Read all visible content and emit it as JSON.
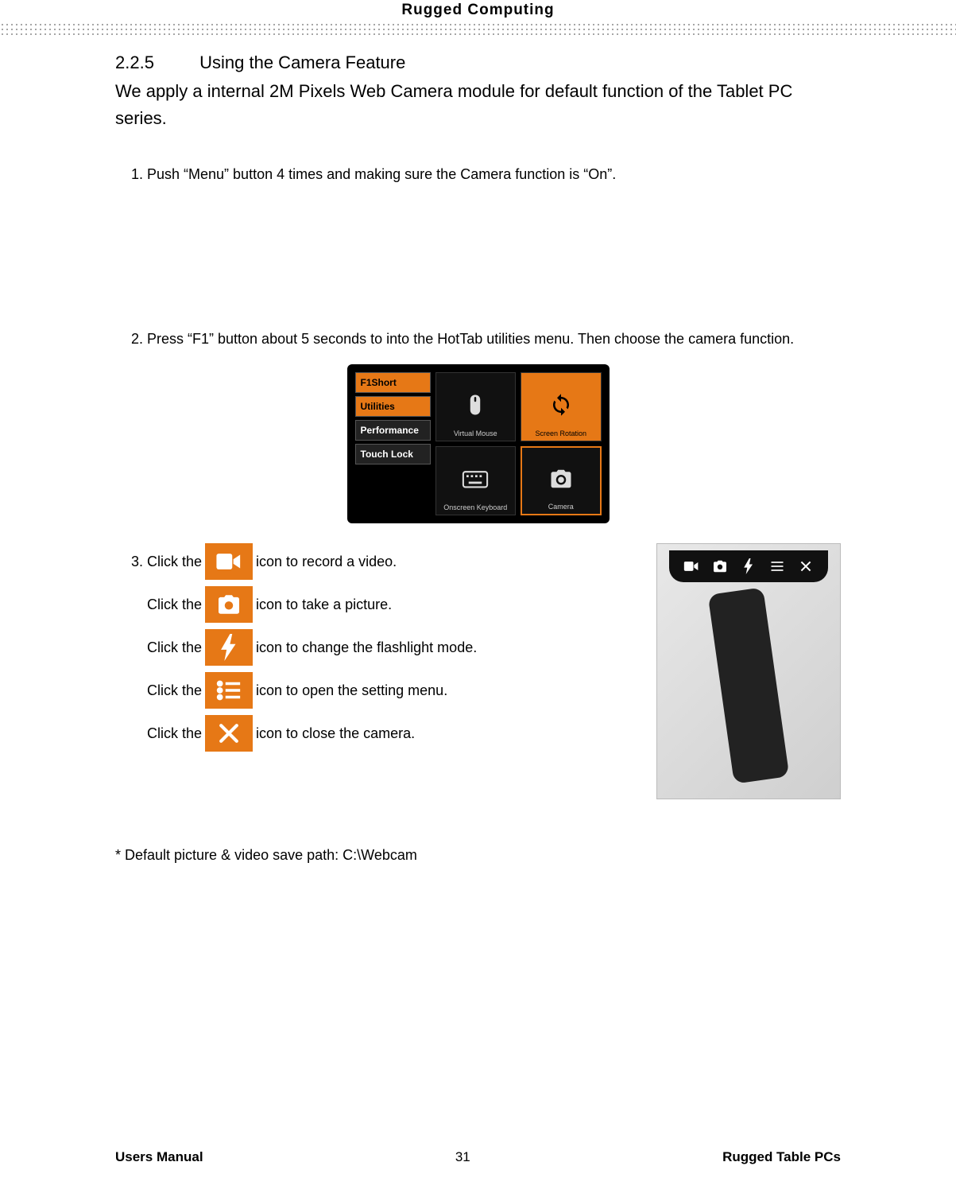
{
  "header": {
    "title": "Rugged  Computing"
  },
  "section": {
    "number": "2.2.5",
    "title": "Using the Camera Feature",
    "intro": "We apply a internal 2M Pixels Web Camera module for default function of the Tablet PC series."
  },
  "steps": {
    "s1": "Push “Menu” button 4 times and making sure the Camera function is “On”.",
    "s2": "Press “F1” button about 5 seconds to into the HotTab utilities menu. Then choose the camera function.",
    "s3_prefix": "Click the",
    "s3_icons": {
      "video": {
        "pre": "Click the",
        "post": " icon to record a video."
      },
      "photo": {
        "pre": "Click the",
        "post": " icon to take a picture."
      },
      "flash": {
        "pre": "Click the",
        "post": " icon to change the flashlight mode."
      },
      "settings": {
        "pre": "Click the",
        "post": " icon to open the setting menu."
      },
      "close": {
        "pre": "Click the",
        "post": " icon to close the camera."
      }
    }
  },
  "hottab": {
    "left": {
      "f1": "F1Short",
      "utilities": "Utilities",
      "performance": "Performance",
      "touchlock": "Touch Lock"
    },
    "tiles": {
      "vm": "Virtual Mouse",
      "sr": "Screen Rotation",
      "ok": "Onscreen Keyboard",
      "cam": "Camera"
    }
  },
  "note": "* Default picture & video save path: C:\\Webcam",
  "footer": {
    "left": "Users Manual",
    "page": "31",
    "right": "Rugged Table PCs"
  }
}
